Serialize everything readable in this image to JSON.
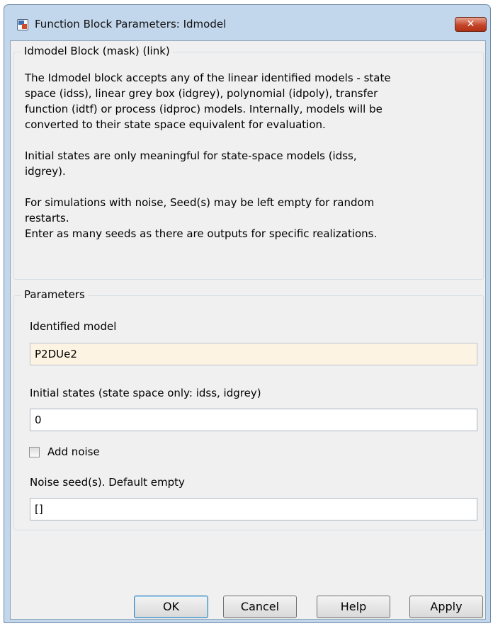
{
  "window": {
    "title": "Function Block Parameters: Idmodel",
    "close_glyph": "✕"
  },
  "description_group": {
    "legend": "Idmodel Block (mask) (link)",
    "lines": [
      "The Idmodel block accepts any of the linear identified models - state",
      "space (idss), linear grey box (idgrey), polynomial (idpoly), transfer",
      "function (idtf) or process (idproc) models. Internally, models will be",
      "converted to their state space equivalent for evaluation.",
      "Initial states are only meaningful for state-space models (idss,",
      "idgrey).",
      "For simulations  with noise, Seed(s) may be left empty for random",
      "restarts.",
      "Enter as many seeds as there are outputs for specific realizations."
    ]
  },
  "parameters": {
    "legend": "Parameters",
    "identified_model_label": "Identified model",
    "identified_model_value": "P2DUe2",
    "initial_states_label": "Initial states (state space only: idss, idgrey)",
    "initial_states_value": "0",
    "add_noise_label": "Add noise",
    "add_noise_checked": false,
    "noise_seed_label": "Noise seed(s). Default empty",
    "noise_seed_value": "[]"
  },
  "buttons": {
    "ok": "OK",
    "cancel": "Cancel",
    "help": "Help",
    "apply": "Apply"
  },
  "colors": {
    "active_field_background": "#fdf3e3",
    "close_button": "#c4452a",
    "default_button_border": "#3c7fb1"
  }
}
